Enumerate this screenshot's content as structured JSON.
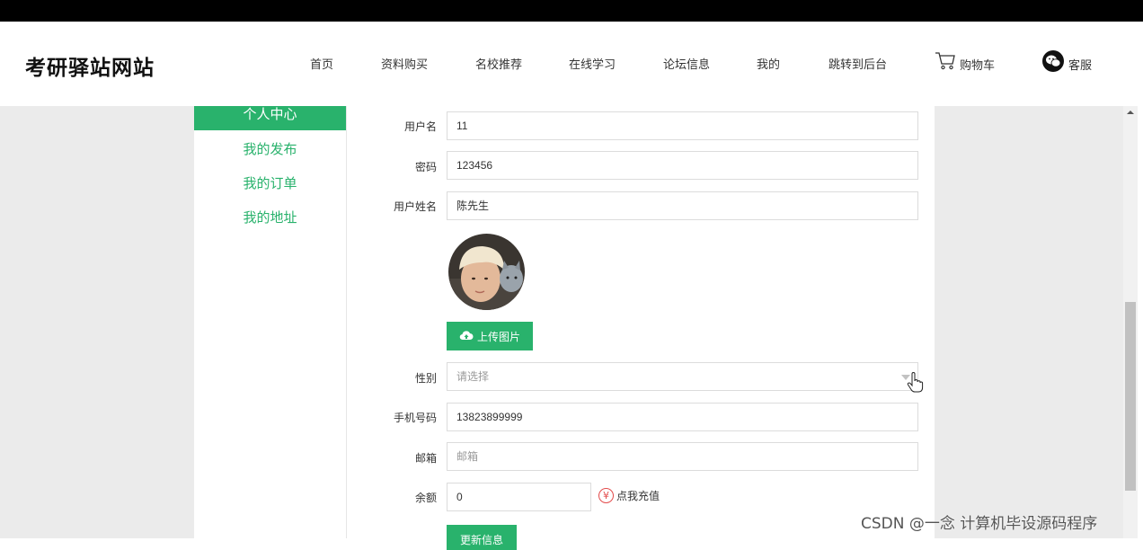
{
  "site": {
    "title": "考研驿站网站"
  },
  "nav": {
    "items": [
      "首页",
      "资料购买",
      "名校推荐",
      "在线学习",
      "论坛信息",
      "我的",
      "跳转到后台"
    ],
    "cart_label": "购物车",
    "service_label": "客服"
  },
  "sidebar": {
    "active": "个人中心",
    "items": [
      "我的发布",
      "我的订单",
      "我的地址"
    ]
  },
  "form": {
    "username": {
      "label": "用户名",
      "value": "11"
    },
    "password": {
      "label": "密码",
      "value": "123456"
    },
    "realname": {
      "label": "用户姓名",
      "value": "陈先生"
    },
    "upload_label": "上传图片",
    "gender": {
      "label": "性别",
      "placeholder": "请选择"
    },
    "phone": {
      "label": "手机号码",
      "value": "13823899999"
    },
    "email": {
      "label": "邮箱",
      "placeholder": "邮箱"
    },
    "balance": {
      "label": "余额",
      "value": "0",
      "recharge_label": "点我充值",
      "currency_symbol": "¥"
    },
    "update_label": "更新信息"
  },
  "watermark": "CSDN @一念 计算机毕设源码程序",
  "colors": {
    "accent": "#29b26c",
    "recharge": "#e34b4b"
  }
}
